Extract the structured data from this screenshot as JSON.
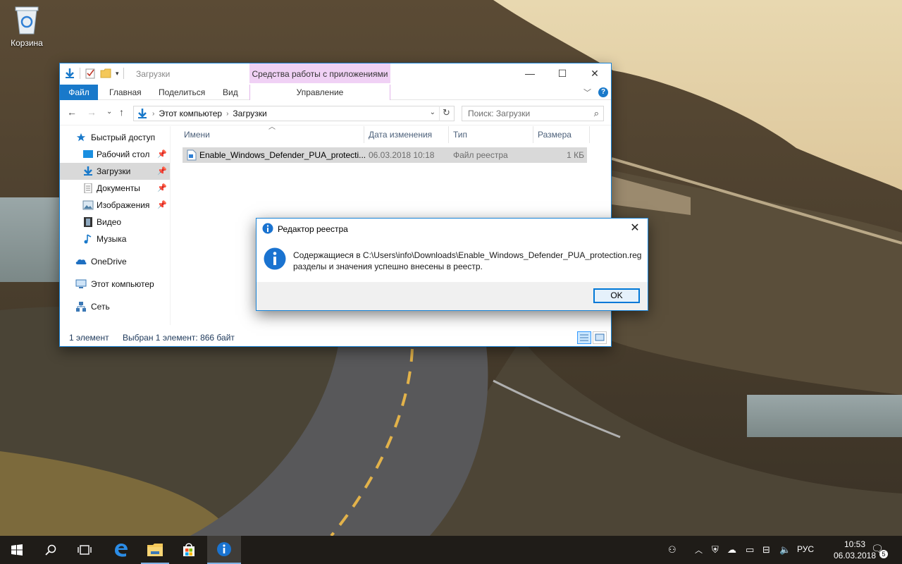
{
  "desktop": {
    "recycle_bin_label": "Корзина"
  },
  "explorer": {
    "title": "Загрузки",
    "context_tab_header": "Средства работы с приложениями",
    "tabs": [
      "Файл",
      "Главная",
      "Поделиться",
      "Вид",
      "Управление"
    ],
    "address": {
      "segments": [
        "Этот компьютер",
        "Загрузки"
      ]
    },
    "search": {
      "placeholder": "Поиск: Загрузки"
    },
    "nav": [
      {
        "label": "Быстрый доступ",
        "icon": "star-icon"
      },
      {
        "label": "Рабочий стол",
        "icon": "desktop-folder-icon",
        "pinned": true
      },
      {
        "label": "Загрузки",
        "icon": "downloads-icon",
        "pinned": true,
        "selected": true
      },
      {
        "label": "Документы",
        "icon": "documents-icon",
        "pinned": true
      },
      {
        "label": "Изображения",
        "icon": "pictures-icon",
        "pinned": true
      },
      {
        "label": "Видео",
        "icon": "videos-icon"
      },
      {
        "label": "Музыка",
        "icon": "music-icon"
      },
      {
        "label": "OneDrive",
        "icon": "onedrive-icon"
      },
      {
        "label": "Этот компьютер",
        "icon": "computer-icon"
      },
      {
        "label": "Сеть",
        "icon": "network-icon"
      }
    ],
    "columns": [
      "Имени",
      "Дата изменения",
      "Тип",
      "Размера"
    ],
    "files": [
      {
        "name": "Enable_Windows_Defender_PUA_protecti...",
        "modified": "06.03.2018 10:18",
        "type": "Файл реестра",
        "size": "1 КБ"
      }
    ],
    "status": {
      "count": "1 элемент",
      "selection": "Выбран 1 элемент: 866 байт"
    }
  },
  "dialog": {
    "title": "Редактор реестра",
    "message_line1": "Содержащиеся в C:\\Users\\info\\Downloads\\Enable_Windows_Defender_PUA_protection.reg",
    "message_line2": "разделы и значения успешно внесены в реестр.",
    "ok_label": "OK"
  },
  "taskbar": {
    "language": "РУС",
    "time": "10:53",
    "date": "06.03.2018",
    "notification_count": "5"
  },
  "colors": {
    "accent": "#1979ca",
    "context_tab": "#f0d1f5",
    "taskbar": "#1f1c18"
  }
}
